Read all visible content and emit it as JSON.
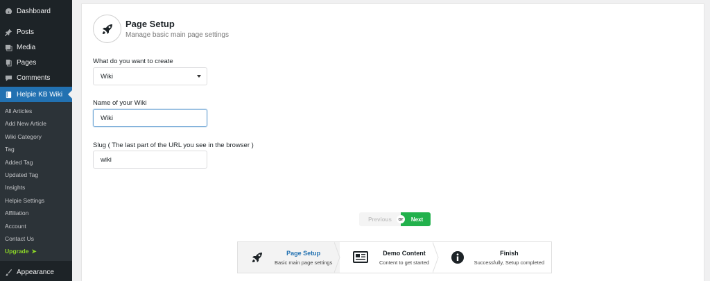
{
  "sidebar": {
    "items_top": [
      {
        "label": "Dashboard",
        "icon": "dashboard-icon"
      },
      {
        "label": "Posts",
        "icon": "pin-icon"
      },
      {
        "label": "Media",
        "icon": "media-icon"
      },
      {
        "label": "Pages",
        "icon": "pages-icon"
      },
      {
        "label": "Comments",
        "icon": "comment-icon"
      }
    ],
    "active_item": {
      "label": "Helpie KB Wiki",
      "icon": "book-icon"
    },
    "submenu": [
      "All Articles",
      "Add New Article",
      "Wiki Category",
      "Tag",
      "Added Tag",
      "Updated Tag",
      "Insights",
      "Helpie Settings",
      "Affiliation",
      "Account",
      "Contact Us"
    ],
    "upgrade_label": "Upgrade",
    "upgrade_arrow": "➤",
    "bottom_item": {
      "label": "Appearance",
      "icon": "brush-icon"
    }
  },
  "header": {
    "title": "Page Setup",
    "subtitle": "Manage basic main page settings"
  },
  "form": {
    "create_label": "What do you want to create",
    "create_value": "Wiki",
    "name_label": "Name of your Wiki",
    "name_value": "Wiki",
    "slug_label": "Slug ( The last part of the URL you see in the browser )",
    "slug_value": "wiki"
  },
  "pager": {
    "previous": "Previous",
    "or": "or",
    "next": "Next"
  },
  "steps": [
    {
      "title": "Page Setup",
      "desc": "Basic main page settings",
      "icon": "rocket-icon"
    },
    {
      "title": "Demo Content",
      "desc": "Content to get started",
      "icon": "newspaper-icon"
    },
    {
      "title": "Finish",
      "desc": "Successfully, Setup completed",
      "icon": "info-icon"
    }
  ],
  "colors": {
    "sidebar_bg": "#1d2327",
    "active_blue": "#2271b1",
    "next_green": "#22b14c",
    "upgrade_green": "#8dd728"
  }
}
